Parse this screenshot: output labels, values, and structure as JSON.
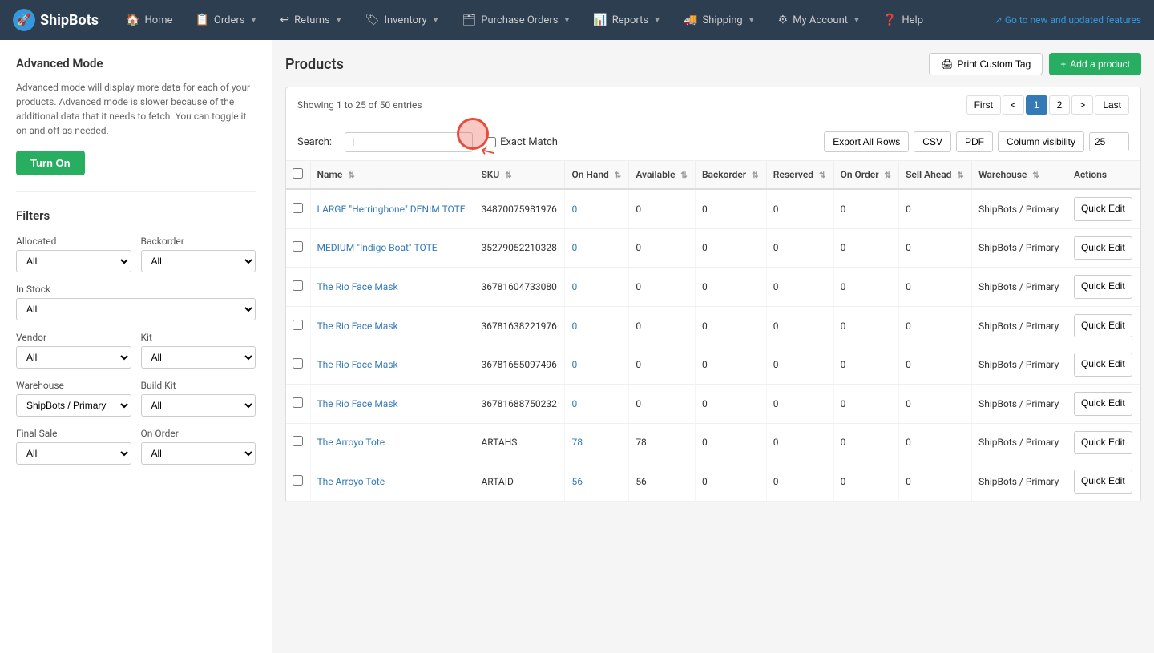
{
  "app": {
    "brand": "ShipBots",
    "banner": "Go to new and updated features"
  },
  "nav": {
    "items": [
      {
        "id": "home",
        "label": "Home",
        "icon": "🏠",
        "hasDropdown": false
      },
      {
        "id": "orders",
        "label": "Orders",
        "icon": "📋",
        "hasDropdown": true
      },
      {
        "id": "returns",
        "label": "Returns",
        "icon": "↩",
        "hasDropdown": true
      },
      {
        "id": "inventory",
        "label": "Inventory",
        "icon": "🏷",
        "hasDropdown": true
      },
      {
        "id": "purchase-orders",
        "label": "Purchase Orders",
        "icon": "🗂",
        "hasDropdown": true
      },
      {
        "id": "reports",
        "label": "Reports",
        "icon": "📊",
        "hasDropdown": true
      },
      {
        "id": "shipping",
        "label": "Shipping",
        "icon": "🚚",
        "hasDropdown": true
      },
      {
        "id": "my-account",
        "label": "My Account",
        "icon": "⚙",
        "hasDropdown": true
      },
      {
        "id": "help",
        "label": "Help",
        "icon": "❓",
        "hasDropdown": false
      }
    ]
  },
  "sidebar": {
    "advanced_mode": {
      "title": "Advanced Mode",
      "description": "Advanced mode will display more data for each of your products. Advanced mode is slower because of the additional data that it needs to fetch. You can toggle it on and off as needed.",
      "button_label": "Turn On"
    },
    "filters": {
      "title": "Filters",
      "rows": [
        {
          "left": {
            "label": "Allocated",
            "value": "All",
            "options": [
              "All"
            ]
          },
          "right": {
            "label": "Backorder",
            "value": "All",
            "options": [
              "All"
            ]
          }
        },
        {
          "left": {
            "label": "In Stock",
            "value": "All",
            "options": [
              "All"
            ]
          },
          "right": null
        },
        {
          "left": {
            "label": "Vendor",
            "value": "All",
            "options": [
              "All"
            ]
          },
          "right": {
            "label": "Kit",
            "value": "All",
            "options": [
              "All"
            ]
          }
        },
        {
          "left": {
            "label": "Warehouse",
            "value": "ShipBots / Primary",
            "options": [
              "ShipBots / Primary",
              "All"
            ]
          },
          "right": {
            "label": "Build Kit",
            "value": "All",
            "options": [
              "All"
            ]
          }
        },
        {
          "left": {
            "label": "Final Sale",
            "value": "All",
            "options": [
              "All"
            ]
          },
          "right": {
            "label": "On Order",
            "value": "All",
            "options": [
              "All"
            ]
          }
        }
      ]
    }
  },
  "products": {
    "title": "Products",
    "print_tag_label": "Print Custom Tag",
    "add_product_label": "Add a product",
    "showing_text": "Showing 1 to 25 of 50 entries",
    "pagination": {
      "first": "First",
      "prev": "<",
      "pages": [
        "1",
        "2"
      ],
      "next": ">",
      "last": "Last",
      "active_page": "1"
    },
    "search": {
      "label": "Search:",
      "placeholder": "",
      "value": "l",
      "exact_match_label": "Exact Match"
    },
    "toolbar_buttons": {
      "export_all": "Export All Rows",
      "csv": "CSV",
      "pdf": "PDF",
      "column_visibility": "Column visibility"
    },
    "per_page": "25",
    "columns": [
      {
        "id": "name",
        "label": "Name"
      },
      {
        "id": "sku",
        "label": "SKU"
      },
      {
        "id": "on_hand",
        "label": "On Hand"
      },
      {
        "id": "available",
        "label": "Available"
      },
      {
        "id": "backorder",
        "label": "Backorder"
      },
      {
        "id": "reserved",
        "label": "Reserved"
      },
      {
        "id": "on_order",
        "label": "On Order"
      },
      {
        "id": "sell_ahead",
        "label": "Sell Ahead"
      },
      {
        "id": "warehouse",
        "label": "Warehouse"
      },
      {
        "id": "actions",
        "label": "Actions"
      }
    ],
    "rows": [
      {
        "name": "LARGE \"Herringbone\" DENIM TOTE",
        "sku": "34870075981976",
        "on_hand": "0",
        "on_hand_blue": true,
        "available": "0",
        "backorder": "0",
        "reserved": "0",
        "on_order": "0",
        "sell_ahead": "0",
        "warehouse": "ShipBots / Primary"
      },
      {
        "name": "MEDIUM \"Indigo Boat\" TOTE",
        "sku": "35279052210328",
        "on_hand": "0",
        "on_hand_blue": true,
        "available": "0",
        "backorder": "0",
        "reserved": "0",
        "on_order": "0",
        "sell_ahead": "0",
        "warehouse": "ShipBots / Primary"
      },
      {
        "name": "The Rio Face Mask",
        "sku": "36781604733080",
        "on_hand": "0",
        "on_hand_blue": true,
        "available": "0",
        "backorder": "0",
        "reserved": "0",
        "on_order": "0",
        "sell_ahead": "0",
        "warehouse": "ShipBots / Primary"
      },
      {
        "name": "The Rio Face Mask",
        "sku": "36781638221976",
        "on_hand": "0",
        "on_hand_blue": true,
        "available": "0",
        "backorder": "0",
        "reserved": "0",
        "on_order": "0",
        "sell_ahead": "0",
        "warehouse": "ShipBots / Primary"
      },
      {
        "name": "The Rio Face Mask",
        "sku": "36781655097496",
        "on_hand": "0",
        "on_hand_blue": true,
        "available": "0",
        "backorder": "0",
        "reserved": "0",
        "on_order": "0",
        "sell_ahead": "0",
        "warehouse": "ShipBots / Primary"
      },
      {
        "name": "The Rio Face Mask",
        "sku": "36781688750232",
        "on_hand": "0",
        "on_hand_blue": true,
        "available": "0",
        "backorder": "0",
        "reserved": "0",
        "on_order": "0",
        "sell_ahead": "0",
        "warehouse": "ShipBots / Primary"
      },
      {
        "name": "The Arroyo Tote",
        "sku": "ARTAHS",
        "on_hand": "78",
        "on_hand_blue": true,
        "available": "78",
        "backorder": "0",
        "reserved": "0",
        "on_order": "0",
        "sell_ahead": "0",
        "warehouse": "ShipBots / Primary"
      },
      {
        "name": "The Arroyo Tote",
        "sku": "ARTAID",
        "on_hand": "56",
        "on_hand_blue": true,
        "available": "56",
        "backorder": "0",
        "reserved": "0",
        "on_order": "0",
        "sell_ahead": "0",
        "warehouse": "ShipBots / Primary"
      }
    ]
  }
}
